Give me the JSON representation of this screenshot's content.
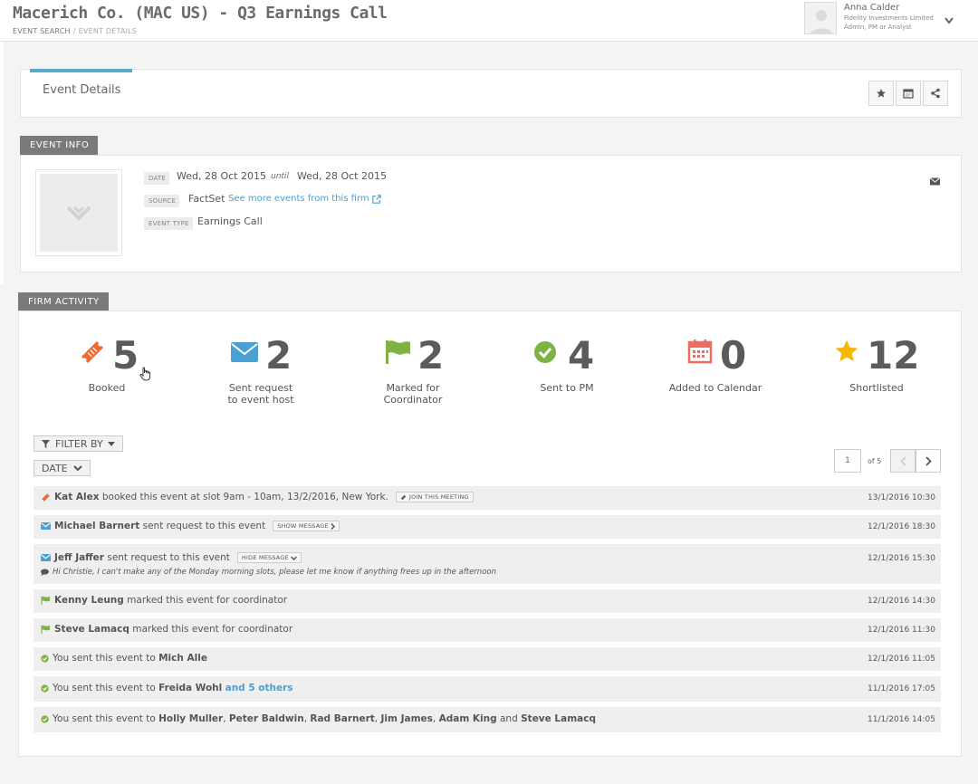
{
  "header": {
    "title": "Macerich Co. (MAC US) - Q3 Earnings Call",
    "breadcrumb": {
      "event_search": "EVENT SEARCH",
      "separator": "/",
      "current": "EVENT DETAILS"
    },
    "user": {
      "name": "Anna Calder",
      "org": "Fidelity Investments Limited",
      "role": "Admin, PM or Analyst"
    }
  },
  "details_panel": {
    "title": "Event Details",
    "actions": [
      "star-icon",
      "calendar-icon",
      "share-icon"
    ]
  },
  "event_info": {
    "section_label": "EVENT INFO",
    "date_label": "DATE",
    "date_start": "Wed, 28 Oct 2015",
    "until": "until",
    "date_end": "Wed, 28 Oct 2015",
    "source_label": "SOURCE",
    "source": "FactSet",
    "source_link": "See more events from this firm",
    "event_type_label": "EVENT TYPE",
    "event_type": "Earnings Call"
  },
  "firm_activity": {
    "section_label": "FIRM ACTIVITY",
    "stats": [
      {
        "value": "5",
        "label": "Booked",
        "icon": "ticket-icon",
        "color": "#ee6b2f"
      },
      {
        "value": "2",
        "label_line1": "Sent request",
        "label_line2": "to event host",
        "icon": "envelope-icon",
        "color": "#4a9fd4"
      },
      {
        "value": "2",
        "label_line1": "Marked for",
        "label_line2": "Coordinator",
        "icon": "flag-icon",
        "color": "#7cb342"
      },
      {
        "value": "4",
        "label": "Sent to PM",
        "icon": "check-circle-icon",
        "color": "#7cb342"
      },
      {
        "value": "0",
        "label": "Added to Calendar",
        "icon": "calendar-icon",
        "color": "#ee6b5f"
      },
      {
        "value": "12",
        "label": "Shortlisted",
        "icon": "star-icon",
        "color": "#f5b800"
      }
    ],
    "filter_label": "FILTER BY",
    "sort_label": "DATE",
    "pager": {
      "current": "1",
      "of": "of 5"
    }
  },
  "activity": [
    {
      "icon": "ticket-icon",
      "name": "Kat Alex",
      "text": "booked this event at slot 9am - 10am, 13/2/2016, New York.",
      "button": "JOIN THIS MEETING",
      "time": "13/1/2016 10:30"
    },
    {
      "icon": "envelope-icon",
      "name": "Michael Barnert",
      "text": "sent request to this event",
      "button": "SHOW MESSAGE",
      "time": "12/1/2016 18:30"
    },
    {
      "icon": "envelope-icon",
      "name": "Jeff Jaffer",
      "text": "sent request to this event",
      "button": "HIDE MESSAGE",
      "message": "Hi Christie, I can't make any of the Monday morning slots, please let me know if anything frees up in the afternoon",
      "time": "12/1/2016 15:30"
    },
    {
      "icon": "flag-icon",
      "name": "Kenny Leung",
      "text": "marked this event for coordinator",
      "time": "12/1/2016 14:30"
    },
    {
      "icon": "flag-icon",
      "name": "Steve Lamacq",
      "text": "marked this event for coordinator",
      "time": "12/1/2016 11:30"
    },
    {
      "icon": "check-circle-icon",
      "prefix": "You sent this event to",
      "name": "Mich Alle",
      "time": "12/1/2016 11:05"
    },
    {
      "icon": "check-circle-icon",
      "prefix": "You sent this event to",
      "name": "Freida Wohl",
      "link": "and 5 others",
      "time": "11/1/2016 17:05"
    },
    {
      "icon": "check-circle-icon",
      "prefix": "You sent this event to",
      "names": [
        "Holly Muller",
        "Peter Baldwin",
        "Rad Barnert",
        "Jim James",
        "Adam King",
        "Steve Lamacq"
      ],
      "and": "and",
      "time": "11/1/2016 14:05"
    }
  ]
}
